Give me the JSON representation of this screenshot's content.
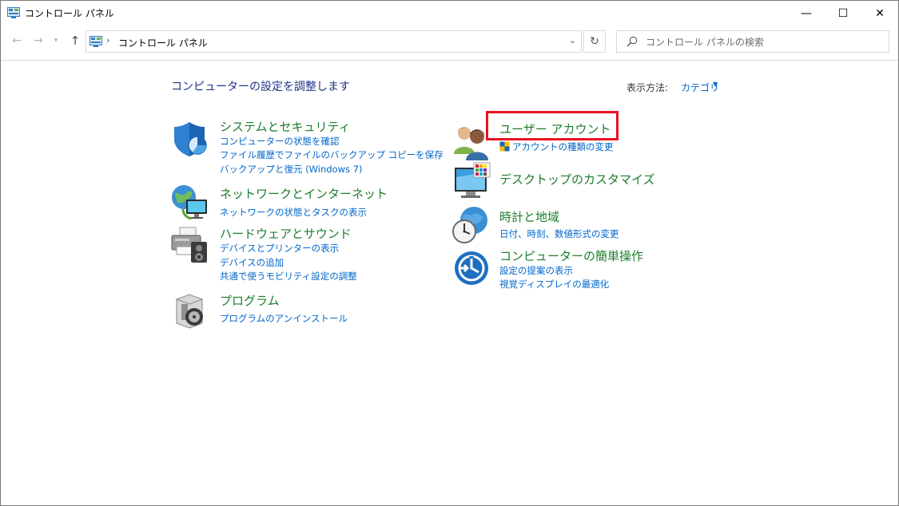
{
  "window": {
    "title": "コントロール パネル",
    "minimize_glyph": "—",
    "maximize_glyph": "☐",
    "close_glyph": "✕"
  },
  "nav": {
    "back_glyph": "←",
    "forward_glyph": "→",
    "recent_glyph": "▾",
    "up_glyph": "↑",
    "breadcrumb_separator": "›",
    "path": "コントロール パネル",
    "dropdown_glyph": "⌄",
    "refresh_glyph": "↻"
  },
  "search": {
    "placeholder": "コントロール パネルの検索"
  },
  "main": {
    "heading": "コンピューターの設定を調整します",
    "view_by_label": "表示方法:",
    "view_by_value": "カテゴリ",
    "view_by_caret": "▼"
  },
  "categories": [
    {
      "title": "システムとセキュリティ",
      "links": [
        "コンピューターの状態を確認",
        "ファイル履歴でファイルのバックアップ コピーを保存",
        "バックアップと復元 (Windows 7)"
      ]
    },
    {
      "title": "ネットワークとインターネット",
      "links": [
        "ネットワークの状態とタスクの表示"
      ]
    },
    {
      "title": "ハードウェアとサウンド",
      "links": [
        "デバイスとプリンターの表示",
        "デバイスの追加",
        "共通で使うモビリティ設定の調整"
      ]
    },
    {
      "title": "プログラム",
      "links": [
        "プログラムのアンインストール"
      ]
    },
    {
      "title": "ユーザー アカウント",
      "links": [
        "アカウントの種類の変更"
      ]
    },
    {
      "title": "デスクトップのカスタマイズ",
      "links": []
    },
    {
      "title": "時計と地域",
      "links": [
        "日付、時刻、数値形式の変更"
      ]
    },
    {
      "title": "コンピューターの簡単操作",
      "links": [
        "設定の提案の表示",
        "視覚ディスプレイの最適化"
      ]
    }
  ],
  "colors": {
    "category_title": "#1c7c2c",
    "link": "#0066cc",
    "heading": "#1e3287",
    "highlight": "#e81123"
  }
}
